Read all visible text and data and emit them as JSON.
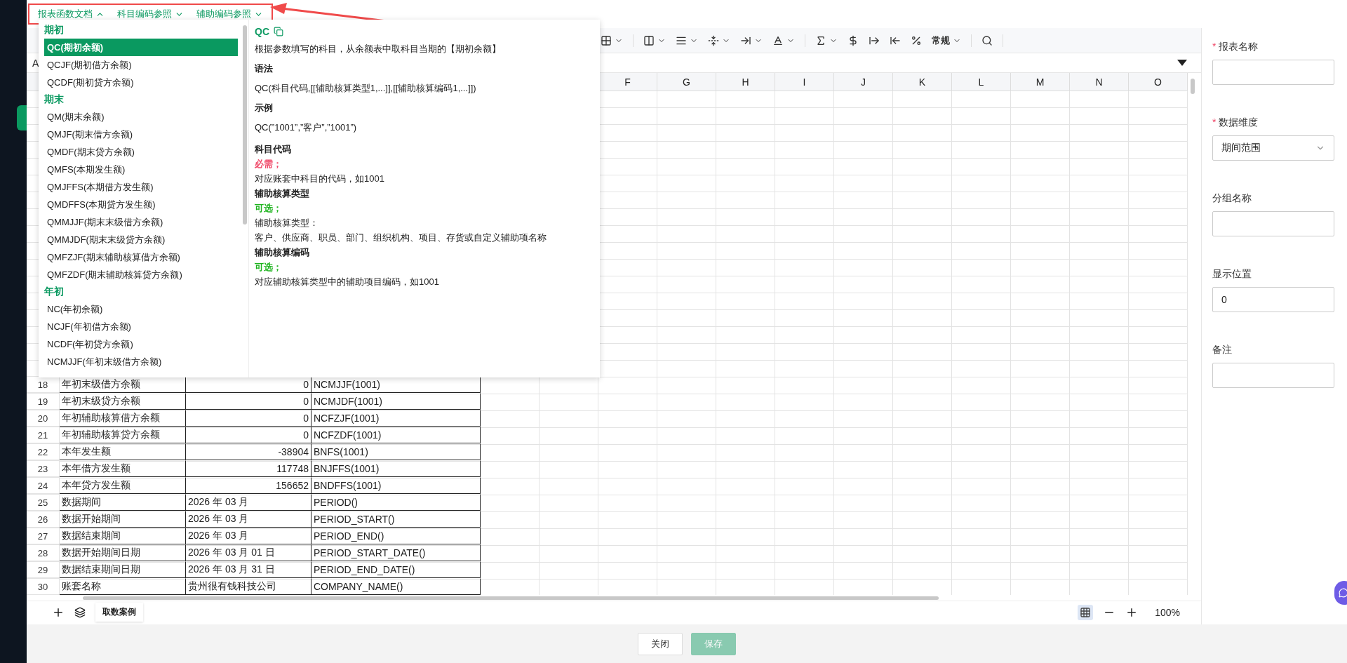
{
  "top_tabs": [
    {
      "label": "报表函数文档",
      "expanded": true
    },
    {
      "label": "科目编码参照",
      "expanded": false
    },
    {
      "label": "辅助编码参照",
      "expanded": false
    }
  ],
  "toolbar": {
    "number_format": "常规"
  },
  "name_box": "A",
  "columns": [
    "F",
    "G",
    "H",
    "I",
    "J",
    "K",
    "L",
    "M",
    "N",
    "O"
  ],
  "rows": [
    {
      "number": "18",
      "cells": [
        {
          "text": "年初末级借方余额",
          "kind": "text"
        },
        {
          "text": "0",
          "kind": "number"
        },
        {
          "text": "NCMJJF(1001)",
          "kind": "text"
        }
      ]
    },
    {
      "number": "19",
      "cells": [
        {
          "text": "年初末级贷方余额",
          "kind": "text"
        },
        {
          "text": "0",
          "kind": "number"
        },
        {
          "text": "NCMJDF(1001)",
          "kind": "text"
        }
      ]
    },
    {
      "number": "20",
      "cells": [
        {
          "text": "年初辅助核算借方余额",
          "kind": "text"
        },
        {
          "text": "0",
          "kind": "number"
        },
        {
          "text": "NCFZJF(1001)",
          "kind": "text"
        }
      ]
    },
    {
      "number": "21",
      "cells": [
        {
          "text": "年初辅助核算贷方余额",
          "kind": "text"
        },
        {
          "text": "0",
          "kind": "number"
        },
        {
          "text": "NCFZDF(1001)",
          "kind": "text"
        }
      ]
    },
    {
      "number": "22",
      "cells": [
        {
          "text": "本年发生额",
          "kind": "text"
        },
        {
          "text": "-38904",
          "kind": "number"
        },
        {
          "text": "BNFS(1001)",
          "kind": "text"
        }
      ]
    },
    {
      "number": "23",
      "cells": [
        {
          "text": "本年借方发生额",
          "kind": "text"
        },
        {
          "text": "117748",
          "kind": "number"
        },
        {
          "text": "BNJFFS(1001)",
          "kind": "text"
        }
      ]
    },
    {
      "number": "24",
      "cells": [
        {
          "text": "本年贷方发生额",
          "kind": "text"
        },
        {
          "text": "156652",
          "kind": "number"
        },
        {
          "text": "BNDFFS(1001)",
          "kind": "text"
        }
      ]
    },
    {
      "number": "25",
      "cells": [
        {
          "text": "数据期间",
          "kind": "text"
        },
        {
          "text": "2026 年 03 月",
          "kind": "text"
        },
        {
          "text": "PERIOD()",
          "kind": "text"
        }
      ]
    },
    {
      "number": "26",
      "cells": [
        {
          "text": "数据开始期间",
          "kind": "text"
        },
        {
          "text": "2026 年 03 月",
          "kind": "text"
        },
        {
          "text": "PERIOD_START()",
          "kind": "text"
        }
      ]
    },
    {
      "number": "27",
      "cells": [
        {
          "text": "数据结束期间",
          "kind": "text"
        },
        {
          "text": "2026 年 03 月",
          "kind": "text"
        },
        {
          "text": "PERIOD_END()",
          "kind": "text"
        }
      ]
    },
    {
      "number": "28",
      "cells": [
        {
          "text": "数据开始期间日期",
          "kind": "text"
        },
        {
          "text": "2026 年 03 月 01 日",
          "kind": "text"
        },
        {
          "text": "PERIOD_START_DATE()",
          "kind": "text"
        }
      ]
    },
    {
      "number": "29",
      "cells": [
        {
          "text": "数据结束期间日期",
          "kind": "text"
        },
        {
          "text": "2026 年 03 月 31 日",
          "kind": "text"
        },
        {
          "text": "PERIOD_END_DATE()",
          "kind": "text"
        }
      ]
    },
    {
      "number": "30",
      "cells": [
        {
          "text": "账套名称",
          "kind": "text"
        },
        {
          "text": "贵州很有钱科技公司",
          "kind": "text"
        },
        {
          "text": "COMPANY_NAME()",
          "kind": "text"
        }
      ]
    }
  ],
  "sheet_tabs": [
    {
      "label": "取数案例",
      "selected": true
    }
  ],
  "gridlines": {
    "on": true
  },
  "zoom": "100%",
  "popup": {
    "groups": [
      {
        "title": "期初",
        "items": [
          {
            "label": "QC(期初余额)",
            "selected": true
          },
          {
            "label": "QCJF(期初借方余额)",
            "selected": false
          },
          {
            "label": "QCDF(期初贷方余额)",
            "selected": false
          }
        ]
      },
      {
        "title": "期末",
        "items": [
          {
            "label": "QM(期末余额)",
            "selected": false
          },
          {
            "label": "QMJF(期末借方余额)",
            "selected": false
          },
          {
            "label": "QMDF(期末贷方余额)",
            "selected": false
          },
          {
            "label": "QMFS(本期发生额)",
            "selected": false
          },
          {
            "label": "QMJFFS(本期借方发生额)",
            "selected": false
          },
          {
            "label": "QMDFFS(本期贷方发生额)",
            "selected": false
          },
          {
            "label": "QMMJJF(期末末级借方余额)",
            "selected": false
          },
          {
            "label": "QMMJDF(期末末级贷方余额)",
            "selected": false
          },
          {
            "label": "QMFZJF(期末辅助核算借方余额)",
            "selected": false
          },
          {
            "label": "QMFZDF(期末辅助核算贷方余额)",
            "selected": false
          }
        ]
      },
      {
        "title": "年初",
        "items": [
          {
            "label": "NC(年初余额)",
            "selected": false
          },
          {
            "label": "NCJF(年初借方余额)",
            "selected": false
          },
          {
            "label": "NCDF(年初贷方余额)",
            "selected": false
          },
          {
            "label": "NCMJJF(年初末级借方余额)",
            "selected": false
          }
        ]
      }
    ],
    "detail": {
      "title": "QC",
      "description": "根据参数填写的科目，从余额表中取科目当期的【期初余额】",
      "sections": [
        {
          "heading": "语法",
          "body": "QC(科目代码,[[辅助核算类型1,...]],[[辅助核算编码1,...]])"
        },
        {
          "heading": "示例",
          "body": "QC(”1001”,”客户”,”1001”)"
        }
      ],
      "params": [
        {
          "name": "科目代码",
          "requirement": "必需；",
          "kind": "required",
          "lines": [
            "对应账套中科目的代码，如1001"
          ]
        },
        {
          "name": "辅助核算类型",
          "requirement": "可选；",
          "kind": "optional",
          "lines": [
            "辅助核算类型：",
            "客户、供应商、职员、部门、组织机构、项目、存货或自定义辅助项名称"
          ]
        },
        {
          "name": "辅助核算编码",
          "requirement": "可选；",
          "kind": "optional",
          "lines": [
            "对应辅助核算类型中的辅助项目编码，如1001"
          ]
        }
      ]
    }
  },
  "form": {
    "fields": [
      {
        "label": "报表名称",
        "required_mark": "*",
        "kind": "text"
      },
      {
        "label": "数据维度",
        "required_mark": "*",
        "kind": "select",
        "value": "期间范围"
      },
      {
        "label": "分组名称",
        "kind": "text"
      },
      {
        "label": "显示位置",
        "kind": "text",
        "value": "0"
      },
      {
        "label": "备注",
        "kind": "text"
      }
    ]
  },
  "footer_buttons": [
    {
      "label": "关闭",
      "kind": "default",
      "disabled": false
    },
    {
      "label": "保存",
      "kind": "primary",
      "disabled": true
    }
  ]
}
